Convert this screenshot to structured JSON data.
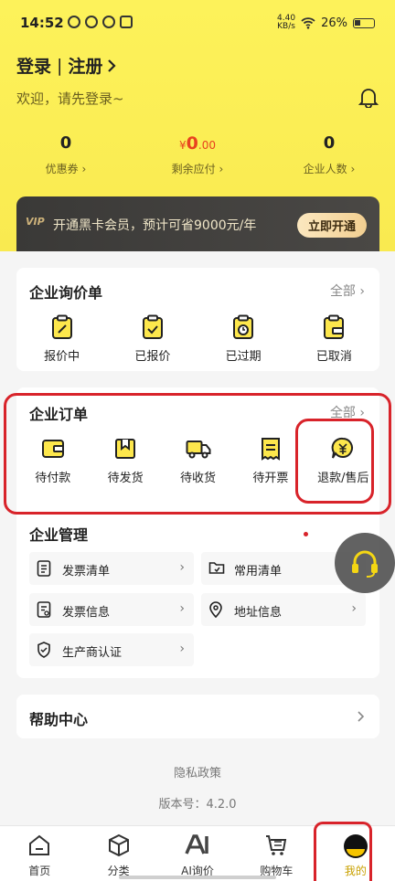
{
  "status": {
    "time": "14:52",
    "net": "4.40",
    "net_unit": "KB/s",
    "battery": "26%"
  },
  "header": {
    "login": "登录",
    "register": "注册",
    "welcome": "欢迎，请先登录~"
  },
  "stats": [
    {
      "value": "0",
      "label": "优惠券"
    },
    {
      "currency": "¥",
      "value": "0",
      "decimals": ".00",
      "label": "剩余应付"
    },
    {
      "value": "0",
      "label": "企业人数"
    }
  ],
  "vip": {
    "logo": "VIP",
    "text": "开通黑卡会员，预计可省9000元/年",
    "button": "立即开通"
  },
  "inquiry": {
    "title": "企业询价单",
    "all": "全部",
    "items": [
      "报价中",
      "已报价",
      "已过期",
      "已取消"
    ]
  },
  "orders": {
    "title": "企业订单",
    "all": "全部",
    "items": [
      "待付款",
      "待发货",
      "待收货",
      "待开票",
      "退款/售后"
    ]
  },
  "management": {
    "title": "企业管理",
    "items": [
      "发票清单",
      "常用清单",
      "发票信息",
      "地址信息",
      "生产商认证"
    ]
  },
  "help": {
    "title": "帮助中心"
  },
  "footer": {
    "privacy": "隐私政策",
    "version": "版本号：4.2.0"
  },
  "tabs": [
    "首页",
    "分类",
    "AI询价",
    "购物车",
    "我的"
  ],
  "colors": {
    "accent": "#fbe94f",
    "price": "#e8421f",
    "highlight": "#d8232a",
    "active": "#f5c400"
  }
}
